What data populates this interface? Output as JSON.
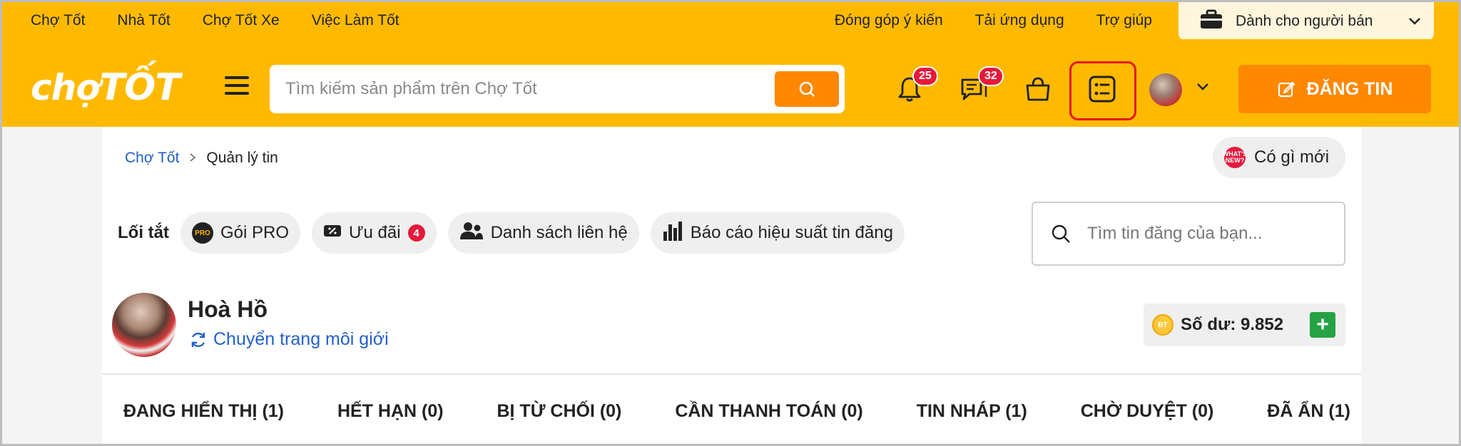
{
  "top_links": [
    "Chợ Tốt",
    "Nhà Tốt",
    "Chợ Tốt Xe",
    "Việc Làm Tốt"
  ],
  "top_right_links": [
    "Đóng góp ý kiến",
    "Tải ứng dụng",
    "Trợ giúp"
  ],
  "seller_label": "Dành cho người bán",
  "logo": {
    "part1": "chợ",
    "part2": "TỐT"
  },
  "search": {
    "placeholder": "Tìm kiếm sản phẩm trên Chợ Tốt"
  },
  "badges": {
    "notifications": "25",
    "messages": "32"
  },
  "post_button": "ĐĂNG TIN",
  "breadcrumb": {
    "home": "Chợ Tốt",
    "current": "Quản lý tin"
  },
  "whats_new": {
    "icon_text": "WHAT'S NEW?",
    "label": "Có gì mới"
  },
  "shortcuts": {
    "label": "Lối tắt",
    "items": [
      {
        "label": "Gói PRO",
        "icon_text": "PRO"
      },
      {
        "label": "Ưu đãi",
        "count": "4"
      },
      {
        "label": "Danh sách liên hệ"
      },
      {
        "label": "Báo cáo hiệu suất tin đăng"
      }
    ]
  },
  "ad_search": {
    "placeholder": "Tìm tin đăng của bạn..."
  },
  "user": {
    "name": "Hoà Hồ",
    "switch_label": "Chuyển trang môi giới"
  },
  "balance": {
    "label": "Số dư: 9.852",
    "coin_text": "ĐT"
  },
  "tabs": [
    "ĐANG HIỂN THỊ (1)",
    "HẾT HẠN (0)",
    "BỊ TỪ CHỐI (0)",
    "CẦN THANH TOÁN (0)",
    "TIN NHÁP (1)",
    "CHỜ DUYỆT (0)",
    "ĐÃ ẨN (1)"
  ],
  "colors": {
    "brand_yellow": "#ffba00",
    "accent_orange": "#ff8800",
    "badge_red": "#e5193b",
    "link_blue": "#2260c9",
    "plus_green": "#25a244",
    "highlight_red": "#e8141b"
  }
}
